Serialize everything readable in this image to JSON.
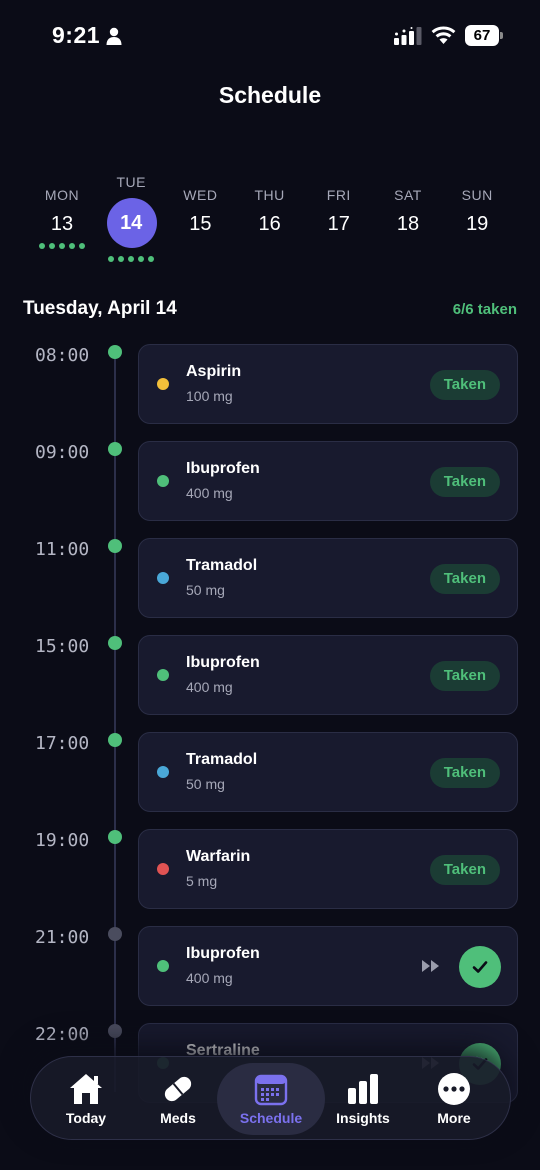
{
  "status_bar": {
    "time": "9:21",
    "battery": "67"
  },
  "header": {
    "title": "Schedule"
  },
  "week": [
    {
      "name": "MON",
      "num": "13",
      "dots": 5,
      "selected": false
    },
    {
      "name": "TUE",
      "num": "14",
      "dots": 5,
      "selected": true
    },
    {
      "name": "WED",
      "num": "15",
      "dots": 0,
      "selected": false
    },
    {
      "name": "THU",
      "num": "16",
      "dots": 0,
      "selected": false
    },
    {
      "name": "FRI",
      "num": "17",
      "dots": 0,
      "selected": false
    },
    {
      "name": "SAT",
      "num": "18",
      "dots": 0,
      "selected": false
    },
    {
      "name": "SUN",
      "num": "19",
      "dots": 0,
      "selected": false
    }
  ],
  "section": {
    "title": "Tuesday, April 14",
    "count": "6/6 taken"
  },
  "schedule": [
    {
      "time": "08:00",
      "name": "Aspirin",
      "dose": "100 mg",
      "color": "#f2bf3a",
      "status": "Taken",
      "done": true
    },
    {
      "time": "09:00",
      "name": "Ibuprofen",
      "dose": "400 mg",
      "color": "#4fbf7a",
      "status": "Taken",
      "done": true
    },
    {
      "time": "11:00",
      "name": "Tramadol",
      "dose": "50 mg",
      "color": "#4aa8d8",
      "status": "Taken",
      "done": true
    },
    {
      "time": "15:00",
      "name": "Ibuprofen",
      "dose": "400 mg",
      "color": "#4fbf7a",
      "status": "Taken",
      "done": true
    },
    {
      "time": "17:00",
      "name": "Tramadol",
      "dose": "50 mg",
      "color": "#4aa8d8",
      "status": "Taken",
      "done": true
    },
    {
      "time": "19:00",
      "name": "Warfarin",
      "dose": "5 mg",
      "color": "#e05353",
      "status": "Taken",
      "done": true
    },
    {
      "time": "21:00",
      "name": "Ibuprofen",
      "dose": "400 mg",
      "color": "#4fbf7a",
      "status": "",
      "done": false
    },
    {
      "time": "22:00",
      "name": "Sertraline",
      "dose": "",
      "color": "#4fbf7a",
      "status": "",
      "done": false
    }
  ],
  "tabs": [
    {
      "label": "Today",
      "icon": "home-icon",
      "active": false
    },
    {
      "label": "Meds",
      "icon": "pill-icon",
      "active": false
    },
    {
      "label": "Schedule",
      "icon": "calendar-icon",
      "active": true
    },
    {
      "label": "Insights",
      "icon": "bar-chart-icon",
      "active": false
    },
    {
      "label": "More",
      "icon": "more-icon",
      "active": false
    }
  ],
  "colors": {
    "accent": "#6b63e6",
    "taken": "#4fbf7a",
    "background": "#0b0c17",
    "card": "#181a2e"
  }
}
